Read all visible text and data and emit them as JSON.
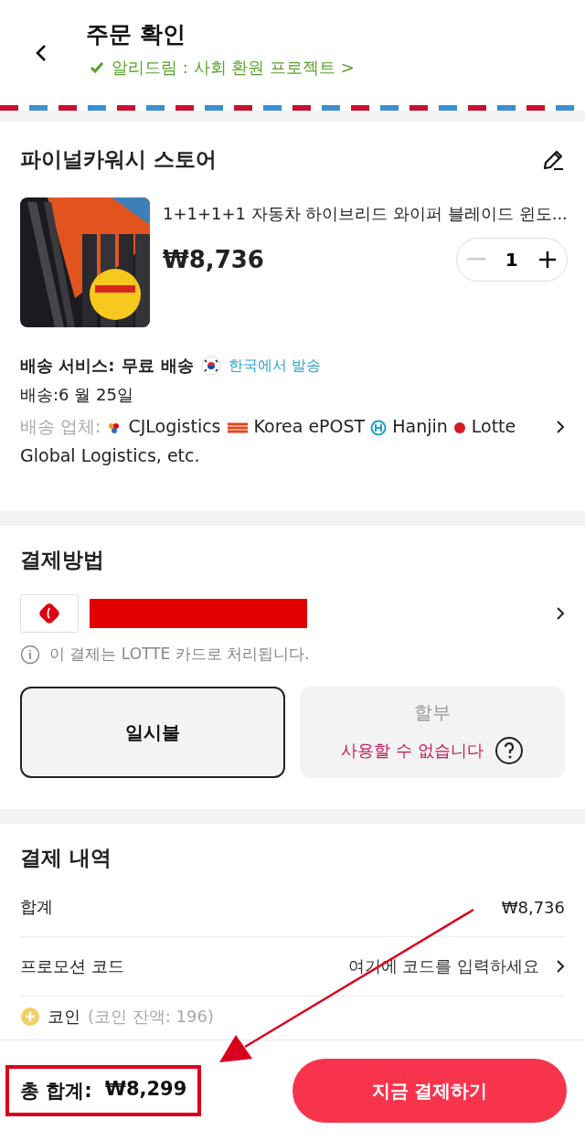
{
  "header": {
    "title": "주문 확인",
    "notice": "알리드림 : 사회 환원 프로젝트 >"
  },
  "store": {
    "name": "파이널카워시 스토어",
    "product": {
      "title": "1+1+1+1 자동차 하이브리드 와이퍼 블레이드 윈도...",
      "price": "₩8,736",
      "quantity": "1"
    },
    "shipping": {
      "label": "배송 서비스:",
      "value": "무료 배송",
      "origin": "한국에서 발송",
      "date": "배송:6 월 25일",
      "carriers_label": "배송 업체:",
      "carriers": [
        {
          "name": "CJLogistics",
          "kind": "cj"
        },
        {
          "name": "Korea ePOST",
          "kind": "post"
        },
        {
          "name": "Hanjin",
          "kind": "hanjin"
        },
        {
          "name": "Lotte",
          "kind": "lotte"
        }
      ],
      "carriers_tail": "Global Logistics, etc."
    }
  },
  "payment": {
    "title": "결제방법",
    "card_note": "이 결제는 LOTTE 카드로 처리됩니다.",
    "options": [
      {
        "label": "일시불",
        "selected": true,
        "disabled": false
      },
      {
        "label": "할부",
        "note": "사용할 수 없습니다",
        "selected": false,
        "disabled": true
      }
    ]
  },
  "summary": {
    "title": "결제 내역",
    "rows": [
      {
        "kind": "amount",
        "label": "합계",
        "value": "₩8,736"
      },
      {
        "kind": "input",
        "label": "프로모션 코드",
        "placeholder": "여기에 코드를 입력하세요"
      }
    ],
    "coin": {
      "label": "코인",
      "balance": "(코인 잔액: 196)"
    }
  },
  "footer": {
    "total_label": "총 합계:",
    "total": "₩8,299",
    "button": "지금 결제하기"
  }
}
